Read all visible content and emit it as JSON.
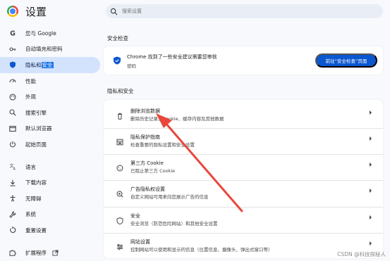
{
  "app": {
    "title": "设置"
  },
  "search": {
    "placeholder": "搜索设置"
  },
  "sidebar": {
    "items": [
      {
        "label": "您与 Google",
        "icon": "google-icon"
      },
      {
        "label": "自动填充和密码",
        "icon": "key-icon"
      },
      {
        "label_pre": "隐私和",
        "label_hl": "安全",
        "icon": "shield-icon"
      },
      {
        "label": "性能",
        "icon": "speedometer-icon"
      },
      {
        "label": "外观",
        "icon": "palette-icon"
      },
      {
        "label": "搜索引擎",
        "icon": "search-icon"
      },
      {
        "label": "默认浏览器",
        "icon": "browser-icon"
      },
      {
        "label": "起始页面",
        "icon": "power-icon"
      },
      {
        "label": "语言",
        "icon": "translate-icon"
      },
      {
        "label": "下载内容",
        "icon": "download-icon"
      },
      {
        "label": "无障碍",
        "icon": "accessibility-icon"
      },
      {
        "label": "系统",
        "icon": "wrench-icon"
      },
      {
        "label": "重置设置",
        "icon": "reset-icon"
      },
      {
        "label": "扩展程序",
        "icon": "extension-icon"
      }
    ]
  },
  "safety_check": {
    "section_title": "安全检查",
    "title": "Chrome 找到了一些安全建议需要您审核",
    "subtitle": "密码",
    "button": "前往“安全检查”页面"
  },
  "privacy": {
    "section_title": "隐私和安全",
    "rows": [
      {
        "title": "删除浏览数据",
        "subtitle": "删除历史记录、Cookie、缓存内容及其他数据",
        "icon": "trash-icon"
      },
      {
        "title": "隐私保护指南",
        "subtitle": "检查重要的隐私设置和安全设置",
        "icon": "privacy-guide-icon"
      },
      {
        "title": "第三方 Cookie",
        "subtitle": "已阻止第三方 Cookie",
        "icon": "cookie-icon"
      },
      {
        "title": "广告隐私权设置",
        "subtitle": "自定义网站可用来向您展示广告的信息",
        "icon": "ad-privacy-icon"
      },
      {
        "title": "安全",
        "subtitle": "安全浏览（防范危险网站）和其他安全设置",
        "icon": "lock-shield-icon"
      },
      {
        "title": "网站设置",
        "subtitle": "控制网站可以使用和显示的信息（位置信息、摄像头、弹出式窗口等）",
        "icon": "sliders-icon"
      }
    ]
  },
  "colors": {
    "accent": "#0b57d0",
    "active_nav": "#d3e3fd",
    "annotation_arrow": "#e8473c"
  },
  "watermark": "CSDN @科技探秘人"
}
